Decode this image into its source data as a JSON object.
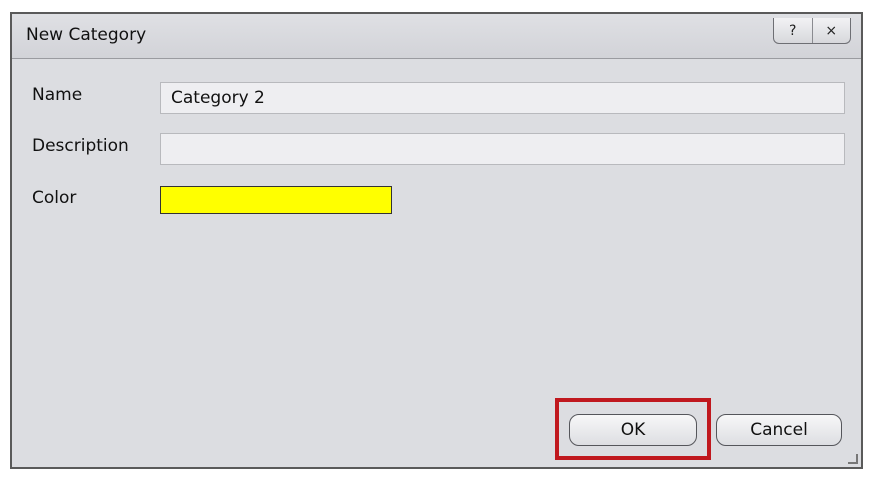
{
  "window": {
    "title": "New Category",
    "help_glyph": "?",
    "close_glyph": "×"
  },
  "form": {
    "name_label": "Name",
    "name_value": "Category 2",
    "description_label": "Description",
    "description_value": "",
    "color_label": "Color",
    "color_value": "#ffff00"
  },
  "buttons": {
    "ok_label": "OK",
    "cancel_label": "Cancel"
  },
  "colors": {
    "highlight": "#c0181e"
  }
}
